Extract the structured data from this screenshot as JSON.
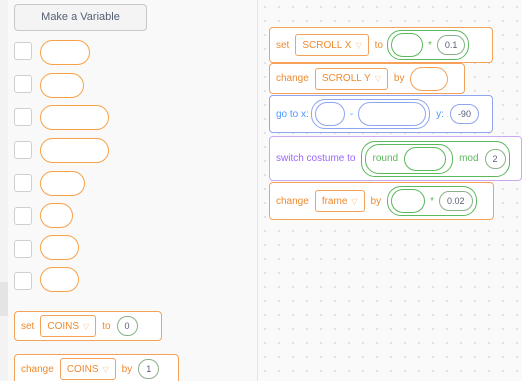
{
  "palette": {
    "make_variable_label": "Make a Variable",
    "set_block": {
      "kw_set": "set",
      "var": "COINS",
      "kw_to": "to",
      "value": "0"
    },
    "change_block": {
      "kw_change": "change",
      "var": "COINS",
      "kw_by": "by",
      "value": "1"
    }
  },
  "script": {
    "set_scroll": {
      "kw_set": "set",
      "var": "SCROLL X",
      "kw_to": "to",
      "op": "*",
      "value": "0.1"
    },
    "change_scroll": {
      "kw_change": "change",
      "var": "SCROLL Y",
      "kw_by": "by"
    },
    "goto": {
      "kw_goto": "go to x:",
      "op": "-",
      "kw_y": "y:",
      "y_value": "-90"
    },
    "costume": {
      "kw": "switch costume to",
      "round": "round",
      "mod": "mod",
      "mod_value": "2"
    },
    "change_frame": {
      "kw_change": "change",
      "var": "frame",
      "kw_by": "by",
      "op": "*",
      "value": "0.02"
    }
  },
  "colors": {
    "variables": "#ff8c1a",
    "motion": "#4c97ff",
    "looks": "#9966ff",
    "operators": "#59c059"
  },
  "icons": [
    "dropdown-caret-icon"
  ]
}
